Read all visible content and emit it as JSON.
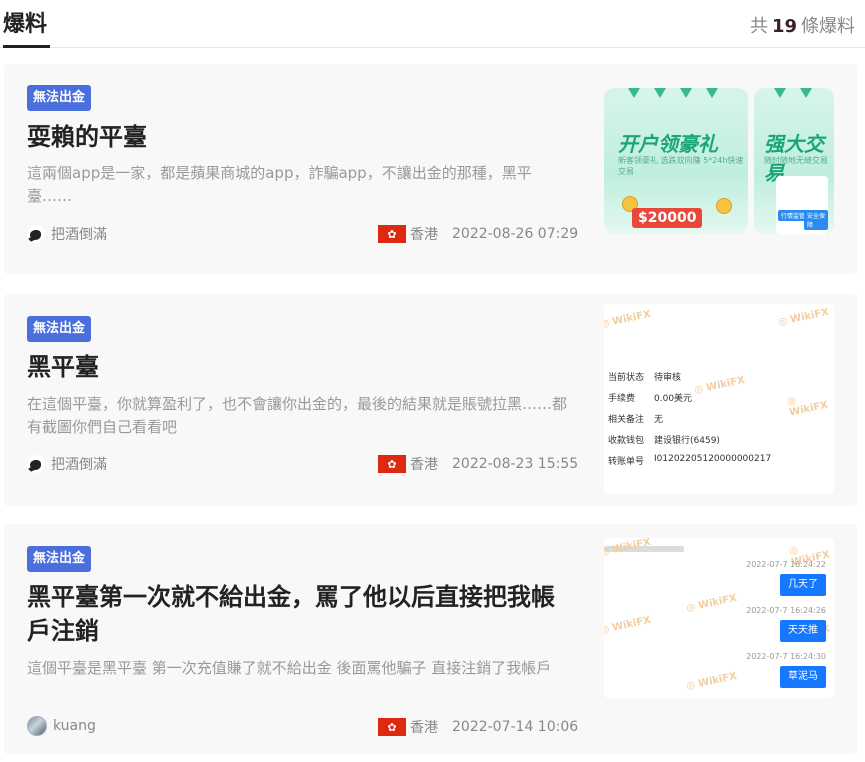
{
  "header": {
    "title": "爆料",
    "count_prefix": "共",
    "count": "19",
    "count_suffix": "條爆料"
  },
  "cards": [
    {
      "badge": "無法出金",
      "title": "耍賴的平臺",
      "desc": "這兩個app是一家，都是蘋果商城的app，詐騙app，不讓出金的那種，黑平臺……",
      "author": "把酒倒滿",
      "avatar_icon": "bird-avatar-icon",
      "flag_icon": "hong-kong-flag-icon",
      "region": "香港",
      "date": "2022-08-26 07:29",
      "thumb": {
        "promo_title": "开户领豪礼",
        "promo_sub": "新客领豪礼 选跌双向赚 5*24h快速交易",
        "promo_amount": "$20000",
        "promo2_title": "强大交易",
        "promo2_sub": "随时随地无缝交易",
        "phone_btn1": "行情监管",
        "phone_btn2": "安全保障"
      }
    },
    {
      "badge": "無法出金",
      "title": "黑平臺",
      "desc": "在這個平臺，你就算盈利了，也不會讓你出金的，最後的結果就是賬號拉黑……都有截圖你們自己看看吧",
      "author": "把酒倒滿",
      "avatar_icon": "bird-avatar-icon",
      "flag_icon": "hong-kong-flag-icon",
      "region": "香港",
      "date": "2022-08-23 15:55",
      "thumb": {
        "watermark": "WikiFX",
        "rows": [
          {
            "k": "当前状态",
            "v": "待审核"
          },
          {
            "k": "手续费",
            "v": "0.00美元"
          },
          {
            "k": "相关备注",
            "v": "无"
          },
          {
            "k": "收款钱包",
            "v": "建设银行(6459)"
          },
          {
            "k": "转账单号",
            "v": "I01202205120000000217"
          }
        ]
      }
    },
    {
      "badge": "無法出金",
      "title": "黑平臺第一次就不給出金，罵了他以后直接把我帳戶注銷",
      "desc": "這個平臺是黑平臺 第一次充值賺了就不給出金 後面罵他騙子 直接注銷了我帳戶",
      "author": "kuang",
      "avatar_icon": "photo-avatar-icon",
      "flag_icon": "hong-kong-flag-icon",
      "region": "香港",
      "date": "2022-07-14 10:06",
      "thumb": {
        "watermark": "WikiFX",
        "messages": [
          {
            "time": "2022-07-7 16:24:22",
            "text": "几天了"
          },
          {
            "time": "2022-07-7 16:24:26",
            "text": "天天推"
          },
          {
            "time": "2022-07-7 16:24:30",
            "text": "草泥马"
          }
        ]
      }
    }
  ]
}
